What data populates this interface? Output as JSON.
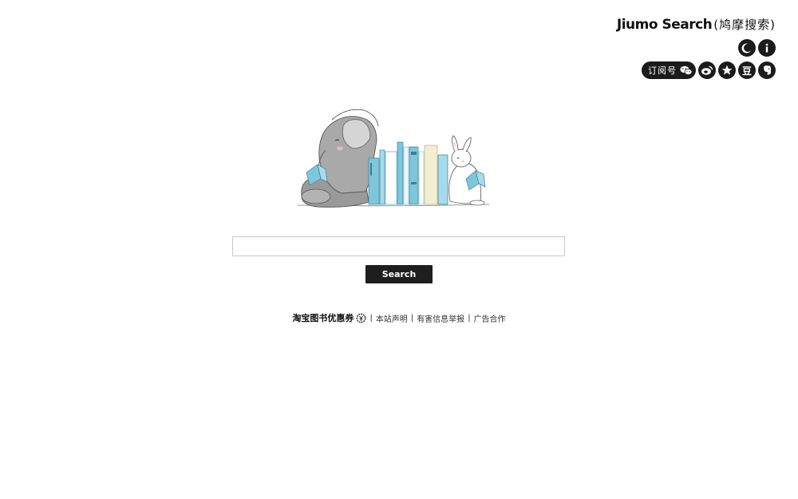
{
  "header": {
    "brand": "Jiumo Search",
    "brand_cn": "(鸠摩搜索)",
    "theme_icon": "moon-icon",
    "info_icon": "info-icon",
    "subscribe_label": "订阅号",
    "wechat_icon": "wechat-icon",
    "weibo_icon": "weibo-icon",
    "favorite_icon": "star-icon",
    "douban_label": "豆",
    "evernote_icon": "evernote-icon"
  },
  "search": {
    "value": "",
    "placeholder": "",
    "button_label": "Search"
  },
  "footer": {
    "promo": "淘宝图书优惠券",
    "coupon_icon": "coupon-icon",
    "links": [
      "本站声明",
      "有害信息举报",
      "广告合作"
    ],
    "separator": "|"
  },
  "colors": {
    "button_bg": "#1e1e1e",
    "book_blue": "#7fc6dc",
    "book_cream": "#f3eed0",
    "elephant_gray": "#9a9a9a"
  }
}
